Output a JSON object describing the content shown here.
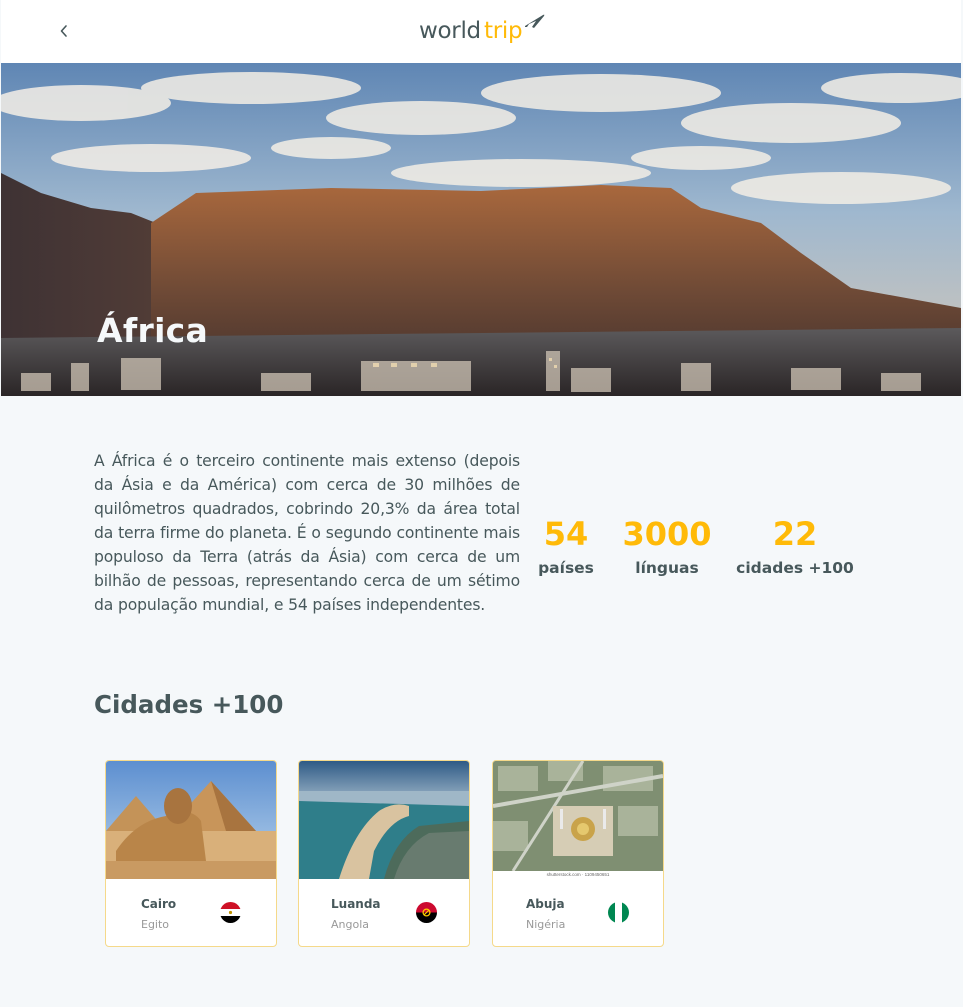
{
  "header": {
    "back_icon": "chevron-left-icon",
    "logo_part1": "world",
    "logo_part2": "trip",
    "logo_icon": "airplane-icon"
  },
  "banner": {
    "title": "África"
  },
  "description": "A África é o terceiro continente mais extenso (depois da Ásia e da América) com cerca de 30 milhões de quilômetros quadrados, cobrindo 20,3% da área total da terra firme do planeta. É o segundo continente mais populoso da Terra (atrás da Ásia) com cerca de um bilhão de pessoas, representando cerca de um sétimo da população mundial, e 54 países independentes.",
  "stats": [
    {
      "value": "54",
      "label": "países"
    },
    {
      "value": "3000",
      "label": "línguas"
    },
    {
      "value": "22",
      "label": "cidades +100"
    }
  ],
  "cities_section": {
    "title": "Cidades +100",
    "cities": [
      {
        "city": "Cairo",
        "country": "Egito",
        "flag_icon": "egypt-flag-icon"
      },
      {
        "city": "Luanda",
        "country": "Angola",
        "flag_icon": "angola-flag-icon"
      },
      {
        "city": "Abuja",
        "country": "Nigéria",
        "flag_icon": "nigeria-flag-icon",
        "image_caption": "shutterstock.com · 1109450651"
      }
    ]
  },
  "colors": {
    "accent": "#ffba08",
    "text": "#47585b",
    "background": "#f5f8fa",
    "muted": "#999999"
  }
}
